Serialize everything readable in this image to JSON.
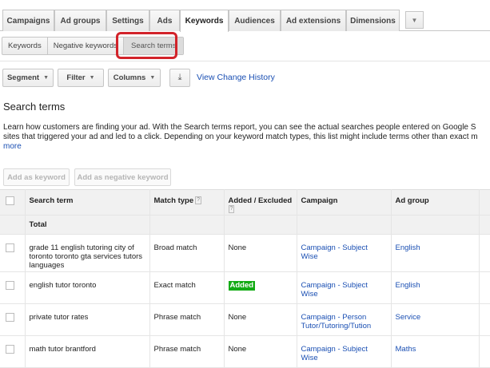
{
  "tabs": [
    {
      "label": "Campaigns",
      "active": false
    },
    {
      "label": "Ad groups",
      "active": false
    },
    {
      "label": "Settings",
      "active": false
    },
    {
      "label": "Ads",
      "active": false
    },
    {
      "label": "Keywords",
      "active": true
    },
    {
      "label": "Audiences",
      "active": false
    },
    {
      "label": "Ad extensions",
      "active": false
    },
    {
      "label": "Dimensions",
      "active": false
    }
  ],
  "tabs_more_glyph": "▼",
  "subtabs": [
    {
      "label": "Keywords",
      "active": false
    },
    {
      "label": "Negative keywords",
      "active": false
    },
    {
      "label": "Search terms",
      "active": true
    }
  ],
  "toolbar": {
    "segment_label": "Segment",
    "filter_label": "Filter",
    "columns_label": "Columns",
    "caret_glyph": "▼",
    "download_glyph": "⤓",
    "history_link": "View Change History"
  },
  "page": {
    "title": "Search terms",
    "description_line1": "Learn how customers are finding your ad. With the Search terms report, you can see the actual searches people entered on Google S",
    "description_line2": "sites that triggered your ad and led to a click. Depending on your keyword match types, this list might include terms other than exact m",
    "more_link": "more"
  },
  "actions": {
    "add_keyword": "Add as keyword",
    "add_negative": "Add as negative keyword"
  },
  "table": {
    "headers": {
      "search_term": "Search term",
      "match_type": "Match type",
      "added_excluded": "Added / Excluded",
      "campaign": "Campaign",
      "ad_group": "Ad group",
      "help_glyph": "?"
    },
    "total_label": "Total",
    "rows": [
      {
        "search_term": "grade 11 english tutoring city of toronto toronto gta services tutors languages",
        "match_type": "Broad match",
        "added_excluded": "None",
        "campaign": "Campaign - Subject Wise",
        "ad_group": "English"
      },
      {
        "search_term": "english tutor toronto",
        "match_type": "Exact match",
        "added_excluded": "Added",
        "campaign": "Campaign - Subject Wise",
        "ad_group": "English"
      },
      {
        "search_term": "private tutor rates",
        "match_type": "Phrase match",
        "added_excluded": "None",
        "campaign": "Campaign - Person Tutor/Tutoring/Tution",
        "ad_group": "Service"
      },
      {
        "search_term": "math tutor brantford",
        "match_type": "Phrase match",
        "added_excluded": "None",
        "campaign": "Campaign - Subject Wise",
        "ad_group": "Maths"
      }
    ]
  },
  "colors": {
    "highlight": "#d2232a",
    "link": "#1a4fb3",
    "added_badge": "#13ab15"
  }
}
